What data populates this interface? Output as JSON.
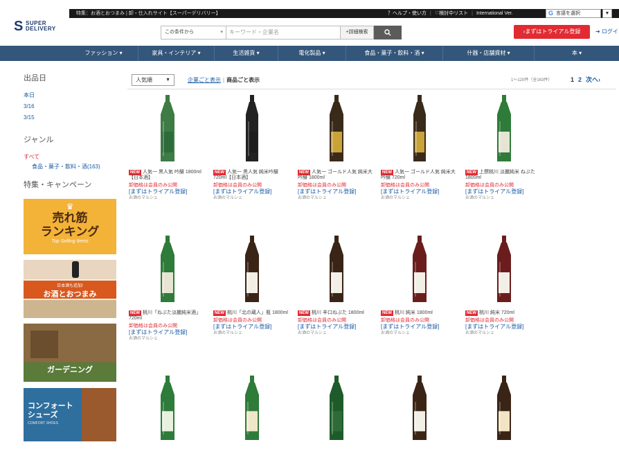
{
  "header": {
    "promo": "特集：お酒とおつまみ | 卸・仕入れサイト【スーパーデリバリー】",
    "help": "？ヘルプ・使い方",
    "wishlist": "♡検討中リスト",
    "intl": "International Ver.",
    "lang_label": "言語を選択",
    "logo_line1": "SUPER",
    "logo_line2": "DELIVERY",
    "search_scope": "この条件から",
    "search_placeholder": "キーワード・企業名",
    "advanced_search": "+詳細検索",
    "trial_button": "›まずはトライアル登録",
    "login": "ログイン"
  },
  "nav": [
    {
      "label": "ファッション ▾"
    },
    {
      "label": "家具・インテリア ▾"
    },
    {
      "label": "生活雑貨 ▾"
    },
    {
      "label": "電化製品 ▾"
    },
    {
      "label": "食品・菓子・飲料・酒 ▾"
    },
    {
      "label": "什器・店舗資材 ▾"
    },
    {
      "label": "本 ▾"
    }
  ],
  "sidebar": {
    "date_heading": "出品日",
    "dates": [
      "本日",
      "3/16",
      "3/15"
    ],
    "genre_heading": "ジャンル",
    "genre_all": "すべて",
    "genre_item": "食品・菓子・飲料・酒(163)",
    "campaign_heading": "特集・キャンペーン",
    "banner1_line1": "売れ筋",
    "banner1_line2": "ランキング",
    "banner1_sub": "Top Selling Items",
    "banner2_sub": "日本酒も追加!",
    "banner2_main": "お酒とおつまみ",
    "banner3_text": "ガーデニング",
    "banner4_line1": "コンフォート",
    "banner4_line2": "シューズ",
    "banner4_sub": "COMFORT SHOES"
  },
  "toolbar": {
    "sort": "人気順",
    "view_company": "企業ごと表示",
    "view_product": "商品ごと表示",
    "range": "1～120件（全163件）",
    "page1": "1",
    "page2": "2",
    "next": "次へ›"
  },
  "common": {
    "new": "NEW",
    "members": "卸価格は会員のみ公開",
    "register": "[まずはトライアル登録]",
    "shop": "お酒のマルシェ"
  },
  "products": [
    {
      "title": "人気一 黒人気 吟醸 1800ml【日本酒】",
      "label_color": "#2e6b3a",
      "bottle_color": "#3e7b45"
    },
    {
      "title": "人気一 黒人気 純米吟醸 720ml【日本酒】",
      "label_color": "#1c1c1c",
      "bottle_color": "#222222"
    },
    {
      "title": "人気一 ゴールド人気 純米大吟醸 1800ml",
      "label_color": "#c9a23a",
      "bottle_color": "#3a2a1a"
    },
    {
      "title": "人気一 ゴールド人気 純米大吟醸 720ml",
      "label_color": "#c9a23a",
      "bottle_color": "#3a2a1a"
    },
    {
      "title": "上撰桃川 淡麗純米 ねぶた 1800ml",
      "label_color": "#e8e4d4",
      "bottle_color": "#2e7b3a"
    },
    {
      "title": "桃川「ねぶた淡麗純米酒」720ml",
      "label_color": "#e8e4d4",
      "bottle_color": "#2e7b3a"
    },
    {
      "title": "桃川「北の蔵人」瓶 1800ml",
      "label_color": "#f2efe6",
      "bottle_color": "#3a2416"
    },
    {
      "title": "桃川 辛口ねぶた 1800ml",
      "label_color": "#f2efe6",
      "bottle_color": "#3a2416"
    },
    {
      "title": "桃川 純米 1800ml",
      "label_color": "#f2efe6",
      "bottle_color": "#6b1d1d"
    },
    {
      "title": "桃川 純米 720ml",
      "label_color": "#f2efe6",
      "bottle_color": "#6b1d1d"
    },
    {
      "title": "",
      "label_color": "#e8f0e0",
      "bottle_color": "#2e7b3a"
    },
    {
      "title": "",
      "label_color": "#f0e6c8",
      "bottle_color": "#2e7b3a"
    },
    {
      "title": "",
      "label_color": "#2e6b3a",
      "bottle_color": "#1e5b2a"
    },
    {
      "title": "",
      "label_color": "#f2efe6",
      "bottle_color": "#3a2416"
    },
    {
      "title": "",
      "label_color": "#f2e4c4",
      "bottle_color": "#3a2416"
    }
  ]
}
